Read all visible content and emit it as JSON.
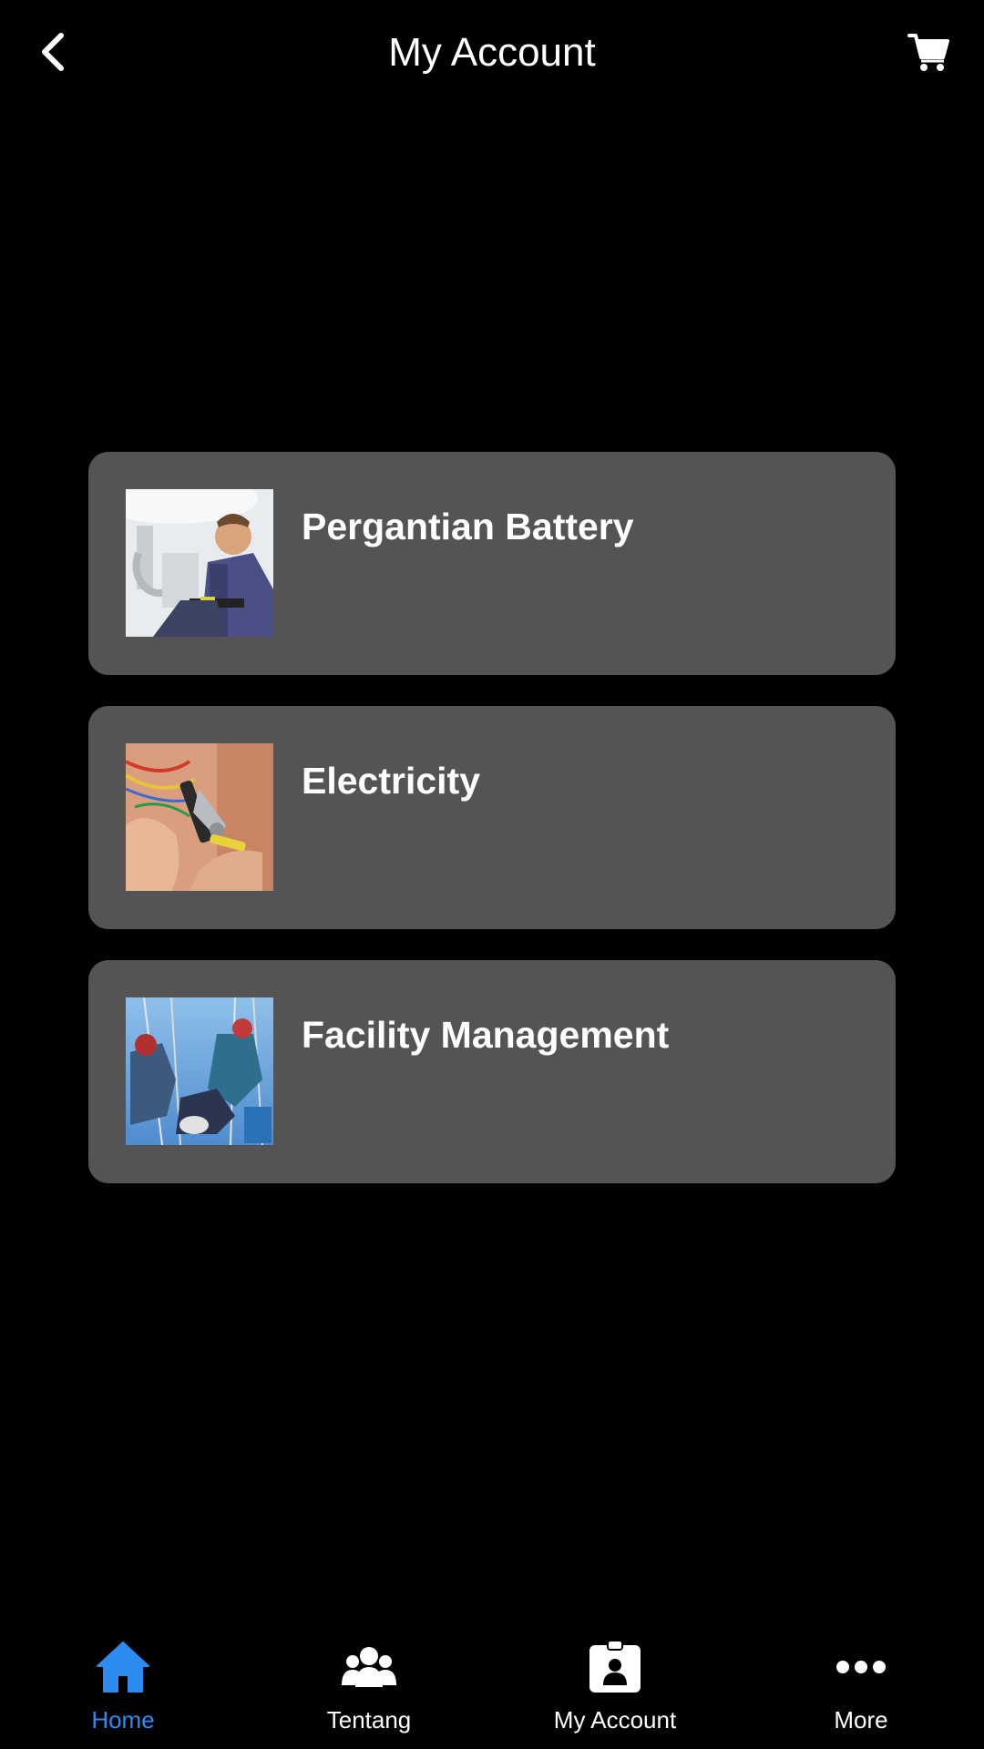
{
  "header": {
    "title": "My Account",
    "back_icon": "chevron-left-icon",
    "cart_icon": "cart-icon"
  },
  "services": [
    {
      "label": "Pergantian Battery",
      "image": "plumber-photo"
    },
    {
      "label": "Electricity",
      "image": "wire-stripper-photo"
    },
    {
      "label": "Facility Management",
      "image": "rope-access-workers-photo"
    }
  ],
  "nav": {
    "active_color": "#2d8cf0",
    "items": [
      {
        "label": "Home",
        "icon": "home-icon",
        "active": true
      },
      {
        "label": "Tentang",
        "icon": "group-icon",
        "active": false
      },
      {
        "label": "My Account",
        "icon": "badge-user-icon",
        "active": false
      },
      {
        "label": "More",
        "icon": "more-dots-icon",
        "active": false
      }
    ]
  },
  "colors": {
    "background": "#000000",
    "card": "#545454",
    "text": "#ffffff"
  }
}
